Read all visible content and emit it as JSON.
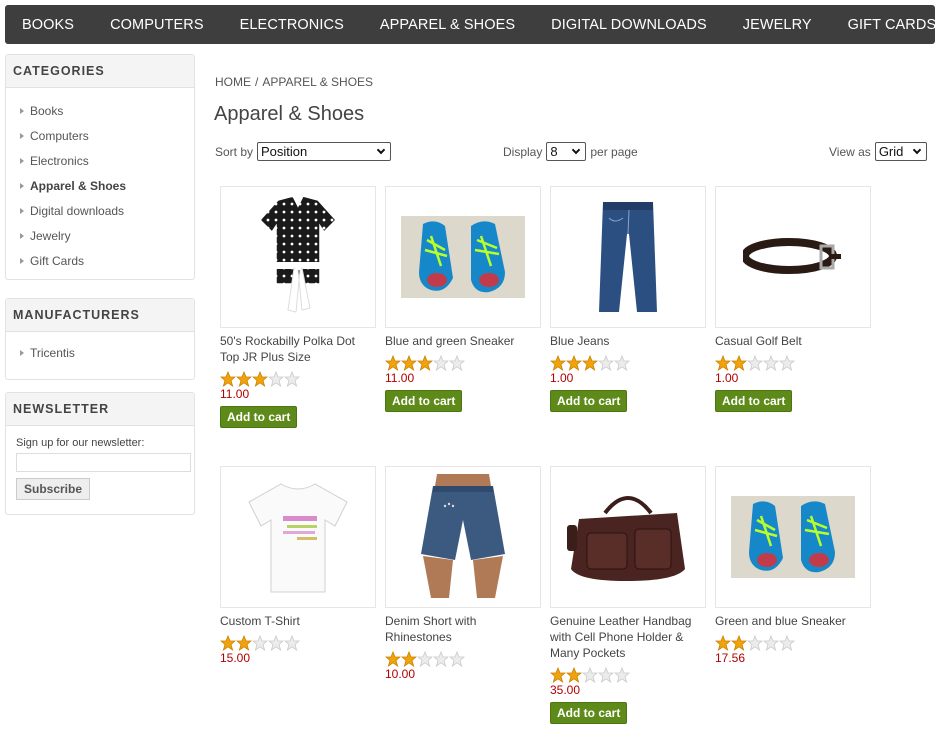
{
  "topmenu": [
    "BOOKS",
    "COMPUTERS",
    "ELECTRONICS",
    "APPAREL & SHOES",
    "DIGITAL DOWNLOADS",
    "JEWELRY",
    "GIFT CARDS"
  ],
  "categories": {
    "title": "CATEGORIES",
    "items": [
      "Books",
      "Computers",
      "Electronics",
      "Apparel & Shoes",
      "Digital downloads",
      "Jewelry",
      "Gift Cards"
    ],
    "active": "Apparel & Shoes"
  },
  "manufacturers": {
    "title": "MANUFACTURERS",
    "items": [
      "Tricentis"
    ]
  },
  "newsletter": {
    "title": "NEWSLETTER",
    "label": "Sign up for our newsletter:",
    "button": "Subscribe",
    "value": ""
  },
  "breadcrumb": {
    "home": "HOME",
    "sep": "/",
    "current": "APPAREL & SHOES"
  },
  "page_title": "Apparel & Shoes",
  "controls": {
    "sort_label": "Sort by",
    "sort_value": "Position",
    "display_label": "Display",
    "display_value": "8",
    "per_page": "per page",
    "view_label": "View as",
    "view_value": "Grid"
  },
  "colors": {
    "menu_bg": "#3e3e3e",
    "price": "#b10000",
    "cart_btn": "#5e8a1a",
    "star": "#f0a30a"
  },
  "cart_label": "Add to cart",
  "products": [
    {
      "name": "50's Rockabilly Polka Dot Top JR Plus Size",
      "rating": 3,
      "price": "11.00",
      "cart": true,
      "image": "polka-dot-top"
    },
    {
      "name": "Blue and green Sneaker",
      "rating": 3,
      "price": "11.00",
      "cart": true,
      "image": "sneaker"
    },
    {
      "name": "Blue Jeans",
      "rating": 3,
      "price": "1.00",
      "cart": true,
      "image": "jeans"
    },
    {
      "name": "Casual Golf Belt",
      "rating": 2,
      "price": "1.00",
      "cart": true,
      "image": "belt"
    },
    {
      "name": "Custom T-Shirt",
      "rating": 2,
      "price": "15.00",
      "cart": false,
      "image": "tshirt"
    },
    {
      "name": "Denim Short with Rhinestones",
      "rating": 2,
      "price": "10.00",
      "cart": false,
      "image": "denim-shorts"
    },
    {
      "name": "Genuine Leather Handbag with Cell Phone Holder & Many Pockets",
      "rating": 2,
      "price": "35.00",
      "cart": true,
      "image": "handbag"
    },
    {
      "name": "Green and blue Sneaker",
      "rating": 2,
      "price": "17.56",
      "cart": false,
      "image": "sneaker"
    }
  ]
}
